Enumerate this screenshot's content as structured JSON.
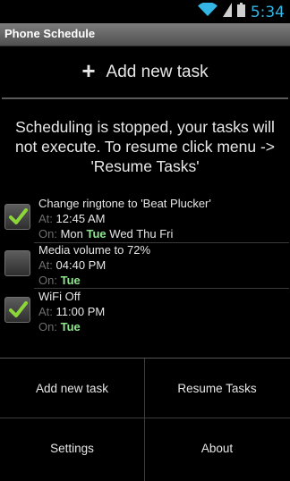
{
  "status": {
    "time": "5:34"
  },
  "app": {
    "title": "Phone Schedule"
  },
  "add_task": {
    "label": "Add new task"
  },
  "message": "Scheduling is stopped, your tasks will not execute. To resume click menu -> 'Resume Tasks'",
  "labels": {
    "at": "At:",
    "on": "On:"
  },
  "tasks": [
    {
      "title": "Change ringtone to 'Beat Plucker'",
      "checked": true,
      "time": "12:45 AM",
      "days": [
        {
          "d": "Mon",
          "active": false
        },
        {
          "d": "Tue",
          "active": true
        },
        {
          "d": "Wed",
          "active": false
        },
        {
          "d": "Thu",
          "active": false
        },
        {
          "d": "Fri",
          "active": false
        }
      ]
    },
    {
      "title": "Media volume to 72%",
      "checked": false,
      "time": "04:40 PM",
      "days": [
        {
          "d": "Tue",
          "active": true
        }
      ]
    },
    {
      "title": "WiFi Off",
      "checked": true,
      "time": "11:00 PM",
      "days": [
        {
          "d": "Tue",
          "active": true
        }
      ]
    }
  ],
  "menu": {
    "add_new_task": "Add new task",
    "resume_tasks": "Resume Tasks",
    "settings": "Settings",
    "about": "About"
  },
  "colors": {
    "accent_time": "#33b5e5",
    "active_day": "#8fe68f",
    "check_green": "#8cd63a"
  }
}
